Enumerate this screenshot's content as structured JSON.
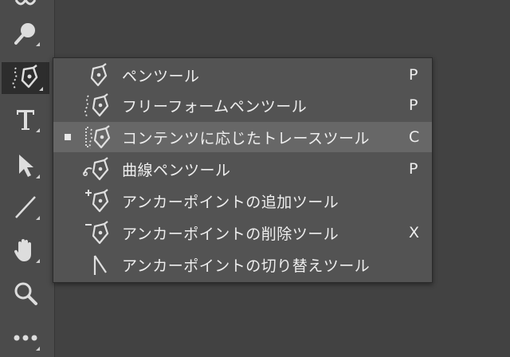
{
  "toolbar": {
    "tools": [
      {
        "name": "partial-tool-icon"
      },
      {
        "name": "stamp-tool-icon"
      },
      {
        "name": "curvature-pen-tool-icon",
        "active": true
      },
      {
        "name": "type-tool-icon",
        "label": "T"
      },
      {
        "name": "path-selection-tool-icon"
      },
      {
        "name": "line-tool-icon"
      },
      {
        "name": "hand-tool-icon"
      },
      {
        "name": "zoom-tool-icon"
      },
      {
        "name": "more-tools-icon",
        "label": "•••"
      }
    ]
  },
  "flyout_menu": {
    "items": [
      {
        "label": "ペンツール",
        "shortcut": "P",
        "icon": "pen-tool-icon",
        "selected": false,
        "checked": false
      },
      {
        "label": "フリーフォームペンツール",
        "shortcut": "P",
        "icon": "freeform-pen-tool-icon",
        "selected": false,
        "checked": false
      },
      {
        "label": "コンテンツに応じたトレースツール",
        "shortcut": "C",
        "icon": "content-aware-tracing-tool-icon",
        "selected": true,
        "checked": true
      },
      {
        "label": "曲線ペンツール",
        "shortcut": "P",
        "icon": "curvature-pen-tool-icon",
        "selected": false,
        "checked": false
      },
      {
        "label": "アンカーポイントの追加ツール",
        "shortcut": "",
        "icon": "add-anchor-point-tool-icon",
        "selected": false,
        "checked": false
      },
      {
        "label": "アンカーポイントの削除ツール",
        "shortcut": "X",
        "icon": "delete-anchor-point-tool-icon",
        "selected": false,
        "checked": false
      },
      {
        "label": "アンカーポイントの切り替えツール",
        "shortcut": "",
        "icon": "convert-point-tool-icon",
        "selected": false,
        "checked": false
      }
    ]
  },
  "colors": {
    "canvas_bg": "#424242",
    "toolbar_bg": "#4b4b4b",
    "menu_bg": "#535353",
    "menu_selected_bg": "#676767",
    "text": "#eeeeee"
  }
}
